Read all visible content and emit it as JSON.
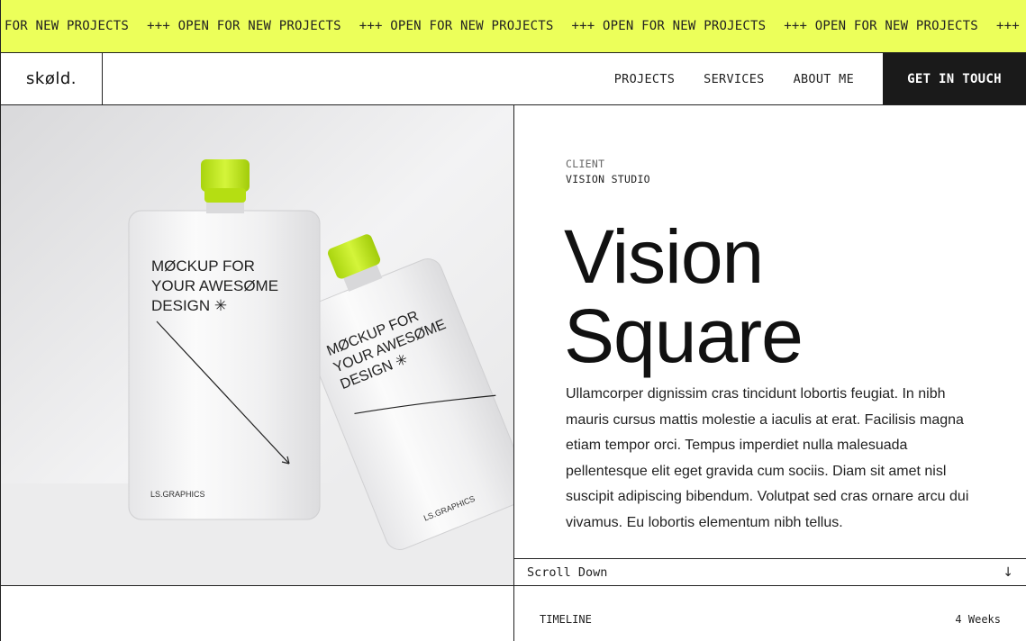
{
  "marquee": {
    "items": [
      "FOR NEW PROJECTS",
      "+++ OPEN FOR NEW PROJECTS",
      "+++ OPEN FOR NEW PROJECTS",
      "+++ OPEN FOR NEW PROJECTS",
      "+++ OPEN FOR NEW PROJECTS",
      "+++ O"
    ],
    "background": "#ecff5a"
  },
  "nav": {
    "logo": "skøld.",
    "links": [
      "PROJECTS",
      "SERVICES",
      "ABOUT ME"
    ],
    "cta": "GET IN TOUCH"
  },
  "hero_image": {
    "pouch_left": {
      "lines": [
        "MØCKUP FOR",
        "YOUR AWESØME",
        "DESIGN ✳"
      ],
      "brand": "LS.GRAPHICS"
    },
    "pouch_right": {
      "lines": [
        "MØCKUP FOR",
        "YOUR AWESØME",
        "DESIGN ✳"
      ],
      "brand": "LS.GRAPHICS"
    },
    "cap_color": "#c6f01a"
  },
  "project": {
    "client_label": "CLIENT",
    "client_name": "VISION STUDIO",
    "title_line1": "Vision",
    "title_line2": "Square",
    "description": "Ullamcorper dignissim cras tincidunt lobortis feugiat. In nibh mauris cursus mattis molestie a iaculis at erat. Facilisis magna etiam tempor orci. Tempus imperdiet nulla malesuada pellentesque elit eget gravida cum sociis. Diam sit amet nisl suscipit adipiscing bibendum. Volutpat sed cras ornare arcu dui vivamus. Eu lobortis elementum nibh tellus."
  },
  "scroll": {
    "label": "Scroll Down",
    "arrow": "↓"
  },
  "timeline": {
    "label": "TIMELINE",
    "value": "4 Weeks"
  }
}
